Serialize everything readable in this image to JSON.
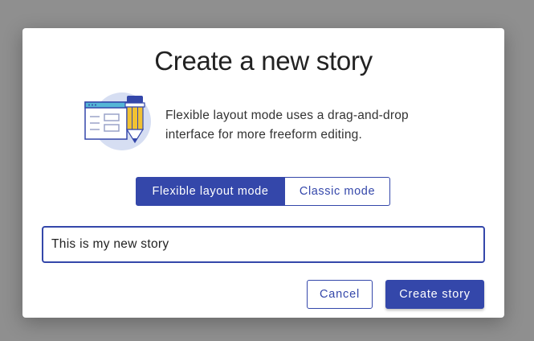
{
  "dialog": {
    "title": "Create a new story",
    "description": "Flexible layout mode uses a drag-and-drop interface for more freeform editing.",
    "illustration_icon": "layout-pencil-icon",
    "modes": [
      {
        "label": "Flexible layout mode",
        "selected": true
      },
      {
        "label": "Classic mode",
        "selected": false
      }
    ],
    "story_name_value": "This is my new story",
    "cancel_label": "Cancel",
    "create_label": "Create story"
  },
  "colors": {
    "accent": "#3447aa",
    "backdrop": "#8f8f8f",
    "pencil_yellow": "#f1c232",
    "illustration_circle": "#d6def2"
  }
}
